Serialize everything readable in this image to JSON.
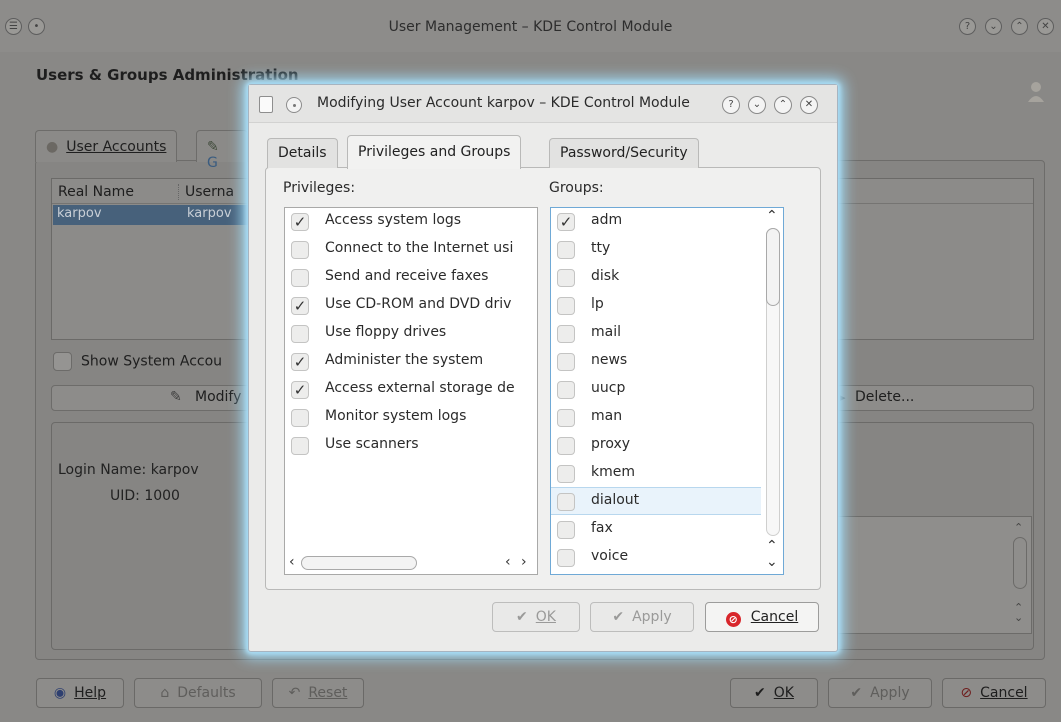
{
  "main_window": {
    "title": "User Management – KDE Control Module",
    "header": "Users & Groups Administration",
    "tabs": [
      {
        "label": "User Accounts"
      },
      {
        "label": "G"
      }
    ],
    "users_table": {
      "columns": [
        "Real Name",
        "Userna"
      ],
      "rows": [
        {
          "real_name": "karpov",
          "username": "karpov"
        }
      ]
    },
    "show_system_label": "Show System Accou",
    "modify_label": "Modify",
    "delete_label": "Delete...",
    "login_name": "Login Name: karpov",
    "uid": "UID: 1000",
    "bottom_buttons": {
      "help": "Help",
      "defaults": "Defaults",
      "reset": "Reset",
      "ok": "OK",
      "apply": "Apply",
      "cancel": "Cancel"
    }
  },
  "dialog": {
    "title": "Modifying User Account karpov – KDE Control Module",
    "tabs": [
      {
        "label": "Details",
        "active": false
      },
      {
        "label": "Privileges and Groups",
        "active": true
      },
      {
        "label": "Password/Security",
        "active": false
      }
    ],
    "privileges_label": "Privileges:",
    "groups_label": "Groups:",
    "privileges": [
      {
        "label": "Access system logs",
        "checked": true
      },
      {
        "label": "Connect to the Internet usi",
        "checked": false
      },
      {
        "label": "Send and receive faxes",
        "checked": false
      },
      {
        "label": "Use CD-ROM and DVD driv",
        "checked": true
      },
      {
        "label": "Use floppy drives",
        "checked": false
      },
      {
        "label": "Administer the system",
        "checked": true
      },
      {
        "label": "Access external storage de",
        "checked": true
      },
      {
        "label": "Monitor system logs",
        "checked": false
      },
      {
        "label": "Use scanners",
        "checked": false
      }
    ],
    "groups": [
      {
        "label": "adm",
        "checked": true
      },
      {
        "label": "tty",
        "checked": false
      },
      {
        "label": "disk",
        "checked": false
      },
      {
        "label": "lp",
        "checked": false
      },
      {
        "label": "mail",
        "checked": false
      },
      {
        "label": "news",
        "checked": false
      },
      {
        "label": "uucp",
        "checked": false
      },
      {
        "label": "man",
        "checked": false
      },
      {
        "label": "proxy",
        "checked": false
      },
      {
        "label": "kmem",
        "checked": false
      },
      {
        "label": "dialout",
        "checked": false,
        "highlighted": true
      },
      {
        "label": "fax",
        "checked": false
      },
      {
        "label": "voice",
        "checked": false
      }
    ],
    "buttons": {
      "ok": "OK",
      "apply": "Apply",
      "cancel": "Cancel"
    }
  },
  "icons": {
    "check": "checkmark-icon",
    "cancel": "cancel-icon",
    "help": "help-icon"
  }
}
